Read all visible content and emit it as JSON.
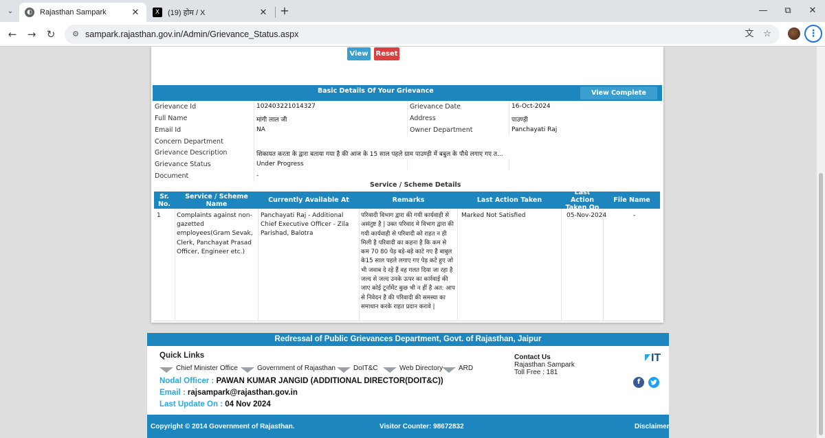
{
  "browser": {
    "tabs": [
      {
        "title": "Rajasthan Sampark",
        "active": true
      },
      {
        "title": "(19) होम / X",
        "active": false
      }
    ],
    "url": "sampark.rajasthan.gov.in/Admin/Grievance_Status.aspx"
  },
  "actions": {
    "view": "View",
    "reset": "Reset"
  },
  "basic": {
    "title": "Basic Details Of Your Grievance",
    "view_complete": "View Complete Details",
    "rows": [
      {
        "l1": "Grievance Id",
        "v1": "102403221014327",
        "l2": "Grievance Date",
        "v2": "16-Oct-2024"
      },
      {
        "l1": "Full Name",
        "v1": "मांगी लाल जी",
        "l2": "Address",
        "v2": "पाउण्ड़ी"
      },
      {
        "l1": "Email Id",
        "v1": "NA",
        "l2": "Owner Department",
        "v2": "Panchayati Raj"
      }
    ],
    "concern_department": "Concern Department",
    "grievance_description_label": "Grievance Description",
    "grievance_description": "शिकायत करता के द्वारा बताया गया है की आज के 15 साल पहले ग्राम पाउण्ड़ी में बबुल के पौधे लगाए गए त...",
    "grievance_status_label": "Grievance Status",
    "grievance_status": "Under Progress",
    "document_label": "Document",
    "document": "-"
  },
  "service": {
    "title": "Service / Scheme Details",
    "headers": {
      "sr": "Sr. No.",
      "scheme": "Service / Scheme Name",
      "available": "Currently Available At",
      "remarks": "Remarks",
      "last_action": "Last Action Taken",
      "last_action_on": "Last Action Taken On",
      "file": "File Name"
    },
    "row": {
      "sr": "1",
      "scheme": "Complaints against non-gazetted employees(Gram Sevak, Clerk, Panchayat Prasad Officer, Engineer etc.)",
      "available": "Panchayati Raj - Additional Chief Executive Officer - Zila Parishad, Balotra",
      "remarks": "परिवादी विभाग द्वारा की गयी कार्यवाही से असंतुष्ट है | उक्त परिवाद मे विभाग द्वारा की गयी कार्यवाही से परिवादी को राहत न ही मिली है परिवादी का कहना है कि कम से कम 70 80 पेड़ बड़े-बड़े काटे गए हैं बाबुल के15 साल पहले लगाए गए पेड़ कटे हुए जो भी जवाब दे रहे हैं वह गलत दिया जा रहा है जल्द से जल्द उनके ऊपर का कार्रवाई की जाए कोई टूर्नामेंट कुछ भी न हीं है अत: आप से निवेदन है की परिवादी की समस्या का समाधान करके राहत प्रदान करावे |",
      "last_action": "Marked Not Satisfied",
      "last_action_on": "05-Nov-2024",
      "file": "-"
    }
  },
  "footer": {
    "heading": "Redressal of Public Grievances Department, Govt. of Rajasthan, Jaipur",
    "quick_links_title": "Quick Links",
    "quick_links": [
      "Chief Minister Office",
      "Government of Rajasthan",
      "DoIT&C",
      "Web Directory",
      "ARD"
    ],
    "nodal_label": "Nodal Officer :",
    "nodal_value": "PAWAN KUMAR JANGID (ADDITIONAL DIRECTOR(DOIT&C))",
    "email_label": "Email :",
    "email_value": "rajsampark@rajasthan.gov.in",
    "update_label": "Last Update On :",
    "update_value": "04 Nov 2024",
    "contact_title": "Contact Us",
    "contact_org": "Rajasthan Sampark",
    "contact_toll": "Toll Free : 181",
    "logo_text": "IT",
    "facebook": "f",
    "copyright": "Copyright © 2014 Government of Rajasthan.",
    "visitor": "Visitor Counter: 98672832",
    "disclaimer": "Disclaimer"
  },
  "colors": {
    "primary": "#1d86bf",
    "button": "#3a9fcf",
    "reset": "#d9403f",
    "accent": "#29a8e0"
  },
  "icons": [
    "tab-search-icon",
    "globe-favicon-icon",
    "x-favicon-icon",
    "close-icon",
    "plus-icon",
    "minimize-icon",
    "restore-icon",
    "window-close-icon",
    "back-arrow-icon",
    "forward-arrow-icon",
    "reload-icon",
    "site-info-icon",
    "translate-icon",
    "star-icon",
    "kebab-menu-icon",
    "facebook-icon",
    "twitter-icon"
  ]
}
